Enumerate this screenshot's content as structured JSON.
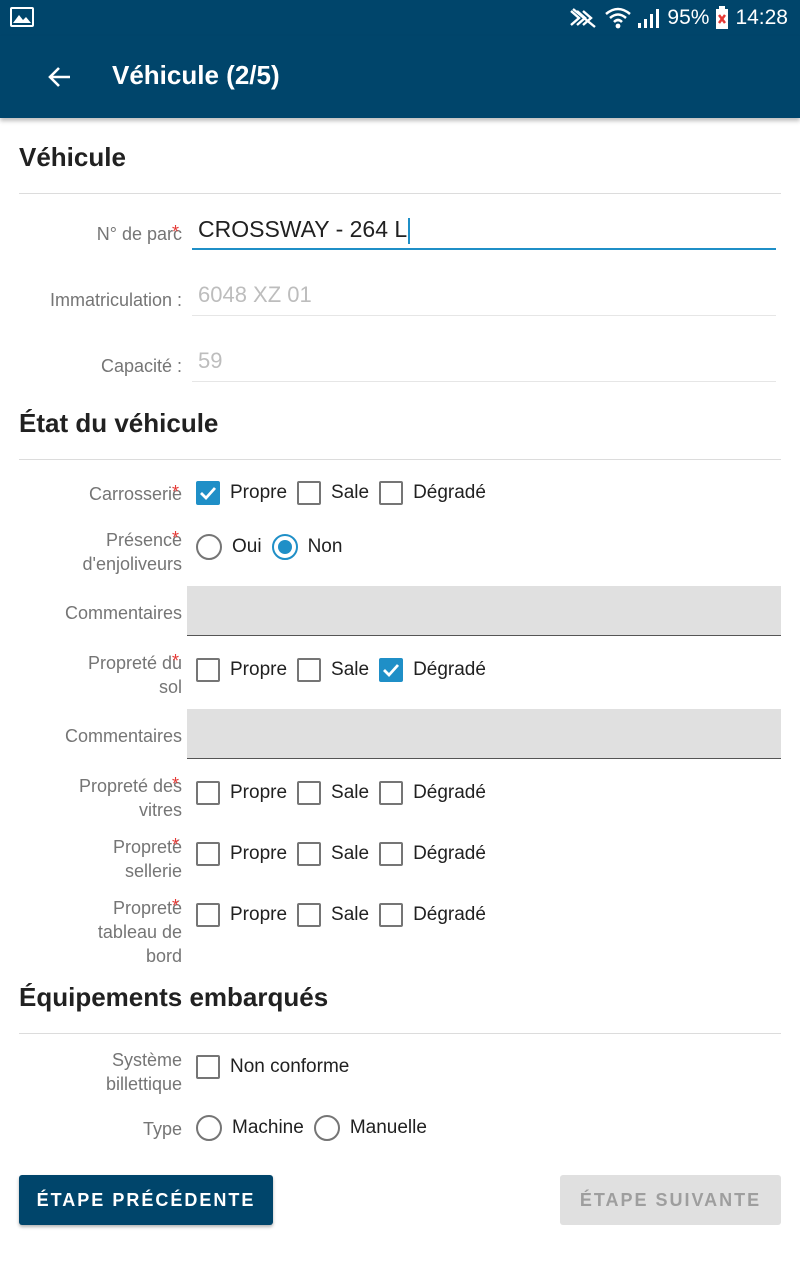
{
  "status": {
    "battery": "95%",
    "time": "14:28"
  },
  "appbar": {
    "title": "Véhicule (2/5)"
  },
  "sections": {
    "vehicule": "Véhicule",
    "etat": "État du véhicule",
    "equipements": "Équipements embarqués"
  },
  "required_mark": "*",
  "fields": {
    "parc": {
      "label": "N° de parc",
      "value": "CROSSWAY - 264 L"
    },
    "immat": {
      "label": "Immatriculation :",
      "value": "6048 XZ 01"
    },
    "capacite": {
      "label": "Capacité :",
      "value": "59"
    }
  },
  "options": {
    "propre": "Propre",
    "sale": "Sale",
    "degrade": "Dégradé",
    "oui": "Oui",
    "non": "Non"
  },
  "etat": {
    "carrosserie": {
      "label": "Carrosserie",
      "selected": "Propre"
    },
    "enjoliveurs": {
      "label_line1": "Présence",
      "label_line2": "d'enjoliveurs",
      "selected": "Non"
    },
    "commentaires_label": "Commentaires",
    "sol": {
      "label_line1": "Propreté du",
      "label_line2": "sol",
      "selected": "Dégradé"
    },
    "vitres": {
      "label_line1": "Propreté des",
      "label_line2": "vitres"
    },
    "sellerie": {
      "label_line1": "Propreté",
      "label_line2": "sellerie"
    },
    "tableau": {
      "label_line1": "Propreté",
      "label_line2": "tableau de",
      "label_line3": "bord"
    }
  },
  "equipements": {
    "billettique": {
      "label_line1": "Système",
      "label_line2": "billettique",
      "option": "Non conforme",
      "checked": false
    },
    "type": {
      "label": "Type",
      "option1": "Machine",
      "option2": "Manuelle"
    }
  },
  "buttons": {
    "prev": "ÉTAPE PRÉCÉDENTE",
    "next": "ÉTAPE SUIVANTE"
  },
  "colors": {
    "primary": "#00456b",
    "accent": "#1f8fc7",
    "required": "#e53935"
  }
}
